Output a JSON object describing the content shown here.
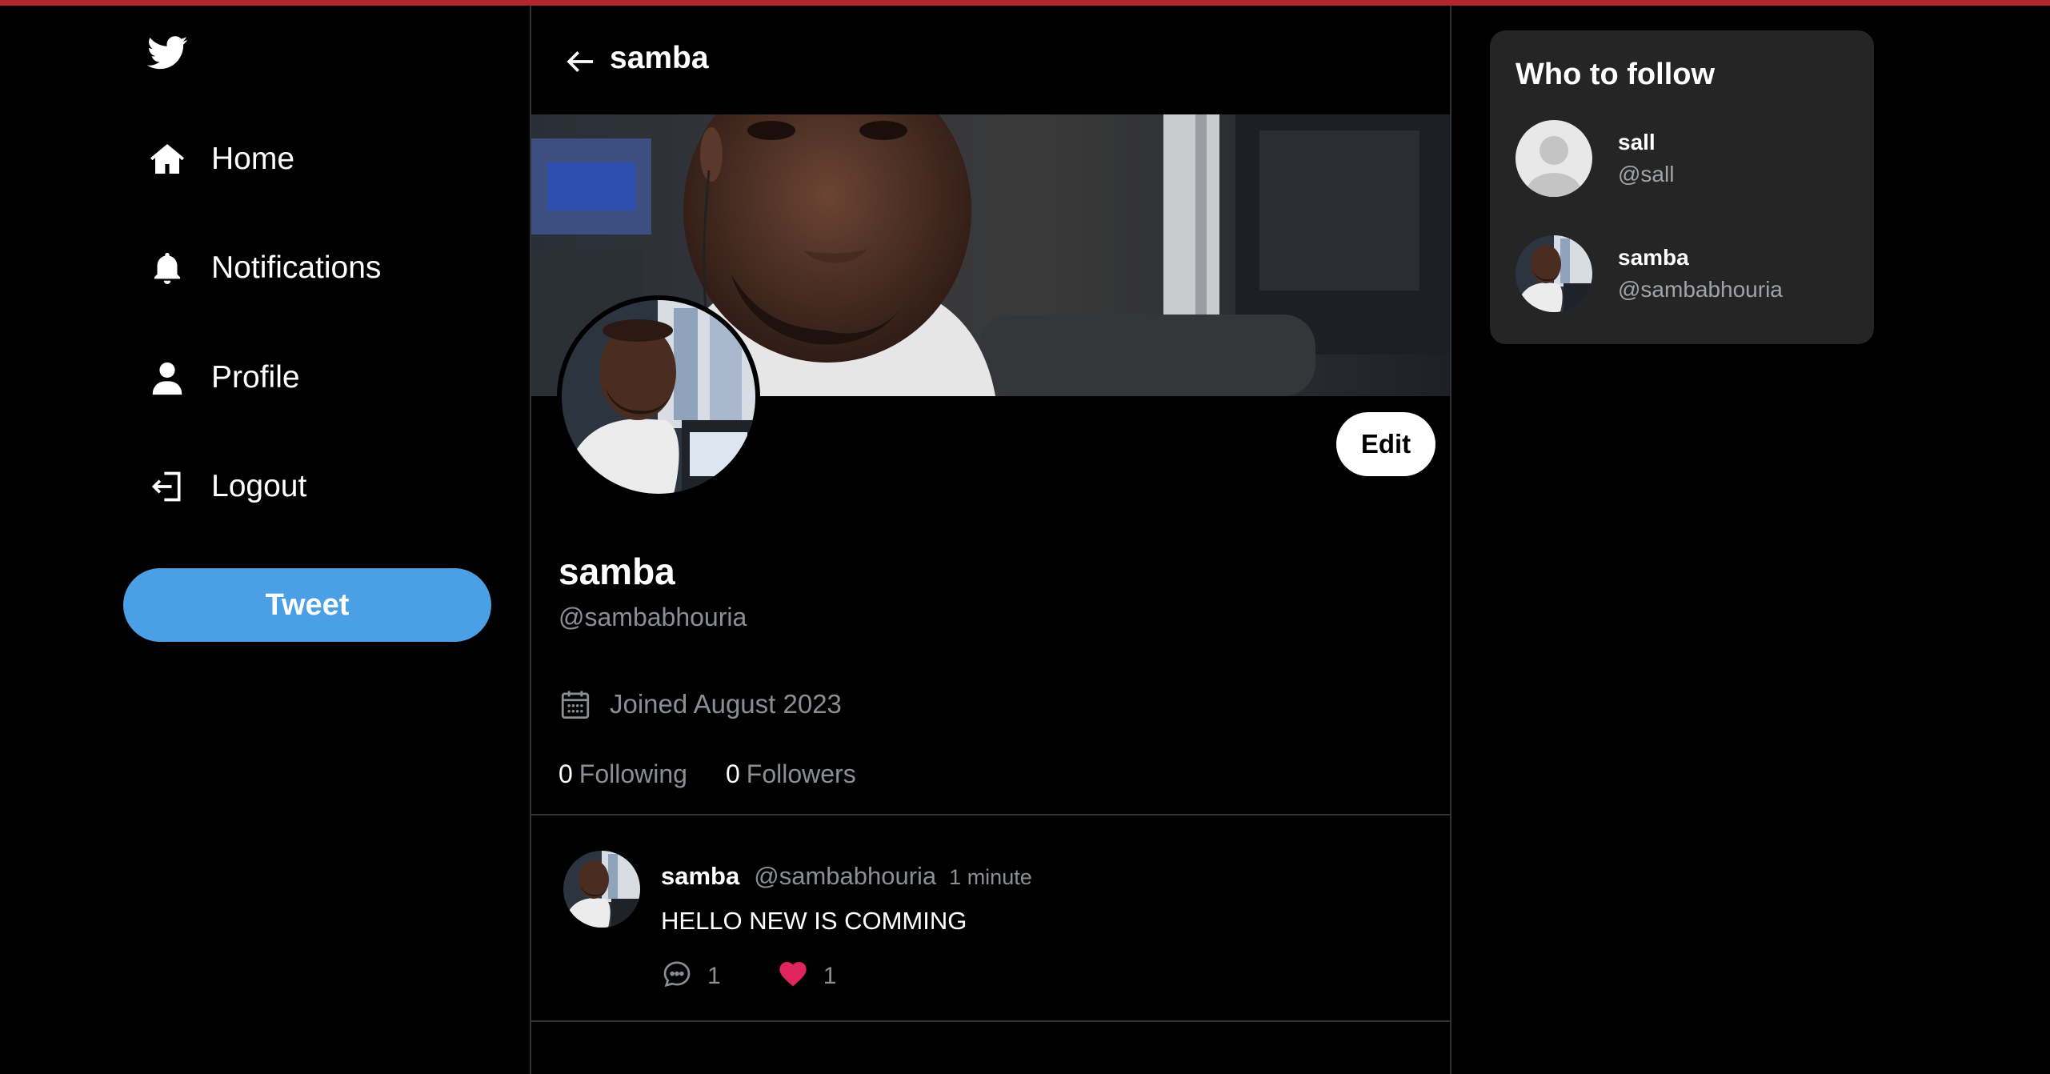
{
  "nav": {
    "logo": "twitter-bird-icon",
    "items": [
      {
        "label": "Home",
        "icon": "home-icon"
      },
      {
        "label": "Notifications",
        "icon": "bell-icon"
      },
      {
        "label": "Profile",
        "icon": "user-icon"
      },
      {
        "label": "Logout",
        "icon": "logout-icon"
      }
    ],
    "tweet_button": "Tweet"
  },
  "header": {
    "back_icon": "arrow-left-icon",
    "title": "samba"
  },
  "profile": {
    "name": "samba",
    "handle": "@sambabhouria",
    "edit_label": "Edit",
    "joined": "Joined August 2023",
    "following_count": "0",
    "following_label": "Following",
    "followers_count": "0",
    "followers_label": "Followers"
  },
  "posts": [
    {
      "name": "samba",
      "handle": "@sambabhouria",
      "time": "1 minute",
      "text": "HELLO NEW IS COMMING",
      "comments": "1",
      "likes": "1"
    }
  ],
  "who_to_follow": {
    "title": "Who to follow",
    "users": [
      {
        "name": "sall",
        "handle": "@sall",
        "avatar": "default-avatar"
      },
      {
        "name": "samba",
        "handle": "@sambabhouria",
        "avatar": "photo-avatar"
      }
    ]
  },
  "colors": {
    "accent": "#4a9fe5",
    "like": "#e0245e",
    "top_bar": "#b3262c",
    "panel_bg": "#252525",
    "muted_text": "#8b8f94"
  }
}
